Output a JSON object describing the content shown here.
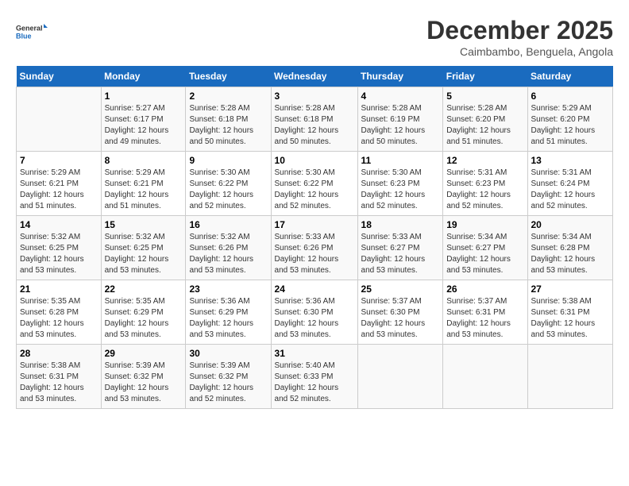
{
  "logo": {
    "line1": "General",
    "line2": "Blue"
  },
  "title": "December 2025",
  "subtitle": "Caimbambo, Benguela, Angola",
  "days": [
    "Sunday",
    "Monday",
    "Tuesday",
    "Wednesday",
    "Thursday",
    "Friday",
    "Saturday"
  ],
  "rows": [
    [
      {
        "date": "",
        "info": ""
      },
      {
        "date": "1",
        "info": "Sunrise: 5:27 AM\nSunset: 6:17 PM\nDaylight: 12 hours\nand 49 minutes."
      },
      {
        "date": "2",
        "info": "Sunrise: 5:28 AM\nSunset: 6:18 PM\nDaylight: 12 hours\nand 50 minutes."
      },
      {
        "date": "3",
        "info": "Sunrise: 5:28 AM\nSunset: 6:18 PM\nDaylight: 12 hours\nand 50 minutes."
      },
      {
        "date": "4",
        "info": "Sunrise: 5:28 AM\nSunset: 6:19 PM\nDaylight: 12 hours\nand 50 minutes."
      },
      {
        "date": "5",
        "info": "Sunrise: 5:28 AM\nSunset: 6:20 PM\nDaylight: 12 hours\nand 51 minutes."
      },
      {
        "date": "6",
        "info": "Sunrise: 5:29 AM\nSunset: 6:20 PM\nDaylight: 12 hours\nand 51 minutes."
      }
    ],
    [
      {
        "date": "7",
        "info": "Sunrise: 5:29 AM\nSunset: 6:21 PM\nDaylight: 12 hours\nand 51 minutes."
      },
      {
        "date": "8",
        "info": "Sunrise: 5:29 AM\nSunset: 6:21 PM\nDaylight: 12 hours\nand 51 minutes."
      },
      {
        "date": "9",
        "info": "Sunrise: 5:30 AM\nSunset: 6:22 PM\nDaylight: 12 hours\nand 52 minutes."
      },
      {
        "date": "10",
        "info": "Sunrise: 5:30 AM\nSunset: 6:22 PM\nDaylight: 12 hours\nand 52 minutes."
      },
      {
        "date": "11",
        "info": "Sunrise: 5:30 AM\nSunset: 6:23 PM\nDaylight: 12 hours\nand 52 minutes."
      },
      {
        "date": "12",
        "info": "Sunrise: 5:31 AM\nSunset: 6:23 PM\nDaylight: 12 hours\nand 52 minutes."
      },
      {
        "date": "13",
        "info": "Sunrise: 5:31 AM\nSunset: 6:24 PM\nDaylight: 12 hours\nand 52 minutes."
      }
    ],
    [
      {
        "date": "14",
        "info": "Sunrise: 5:32 AM\nSunset: 6:25 PM\nDaylight: 12 hours\nand 53 minutes."
      },
      {
        "date": "15",
        "info": "Sunrise: 5:32 AM\nSunset: 6:25 PM\nDaylight: 12 hours\nand 53 minutes."
      },
      {
        "date": "16",
        "info": "Sunrise: 5:32 AM\nSunset: 6:26 PM\nDaylight: 12 hours\nand 53 minutes."
      },
      {
        "date": "17",
        "info": "Sunrise: 5:33 AM\nSunset: 6:26 PM\nDaylight: 12 hours\nand 53 minutes."
      },
      {
        "date": "18",
        "info": "Sunrise: 5:33 AM\nSunset: 6:27 PM\nDaylight: 12 hours\nand 53 minutes."
      },
      {
        "date": "19",
        "info": "Sunrise: 5:34 AM\nSunset: 6:27 PM\nDaylight: 12 hours\nand 53 minutes."
      },
      {
        "date": "20",
        "info": "Sunrise: 5:34 AM\nSunset: 6:28 PM\nDaylight: 12 hours\nand 53 minutes."
      }
    ],
    [
      {
        "date": "21",
        "info": "Sunrise: 5:35 AM\nSunset: 6:28 PM\nDaylight: 12 hours\nand 53 minutes."
      },
      {
        "date": "22",
        "info": "Sunrise: 5:35 AM\nSunset: 6:29 PM\nDaylight: 12 hours\nand 53 minutes."
      },
      {
        "date": "23",
        "info": "Sunrise: 5:36 AM\nSunset: 6:29 PM\nDaylight: 12 hours\nand 53 minutes."
      },
      {
        "date": "24",
        "info": "Sunrise: 5:36 AM\nSunset: 6:30 PM\nDaylight: 12 hours\nand 53 minutes."
      },
      {
        "date": "25",
        "info": "Sunrise: 5:37 AM\nSunset: 6:30 PM\nDaylight: 12 hours\nand 53 minutes."
      },
      {
        "date": "26",
        "info": "Sunrise: 5:37 AM\nSunset: 6:31 PM\nDaylight: 12 hours\nand 53 minutes."
      },
      {
        "date": "27",
        "info": "Sunrise: 5:38 AM\nSunset: 6:31 PM\nDaylight: 12 hours\nand 53 minutes."
      }
    ],
    [
      {
        "date": "28",
        "info": "Sunrise: 5:38 AM\nSunset: 6:31 PM\nDaylight: 12 hours\nand 53 minutes."
      },
      {
        "date": "29",
        "info": "Sunrise: 5:39 AM\nSunset: 6:32 PM\nDaylight: 12 hours\nand 53 minutes."
      },
      {
        "date": "30",
        "info": "Sunrise: 5:39 AM\nSunset: 6:32 PM\nDaylight: 12 hours\nand 52 minutes."
      },
      {
        "date": "31",
        "info": "Sunrise: 5:40 AM\nSunset: 6:33 PM\nDaylight: 12 hours\nand 52 minutes."
      },
      {
        "date": "",
        "info": ""
      },
      {
        "date": "",
        "info": ""
      },
      {
        "date": "",
        "info": ""
      }
    ]
  ]
}
